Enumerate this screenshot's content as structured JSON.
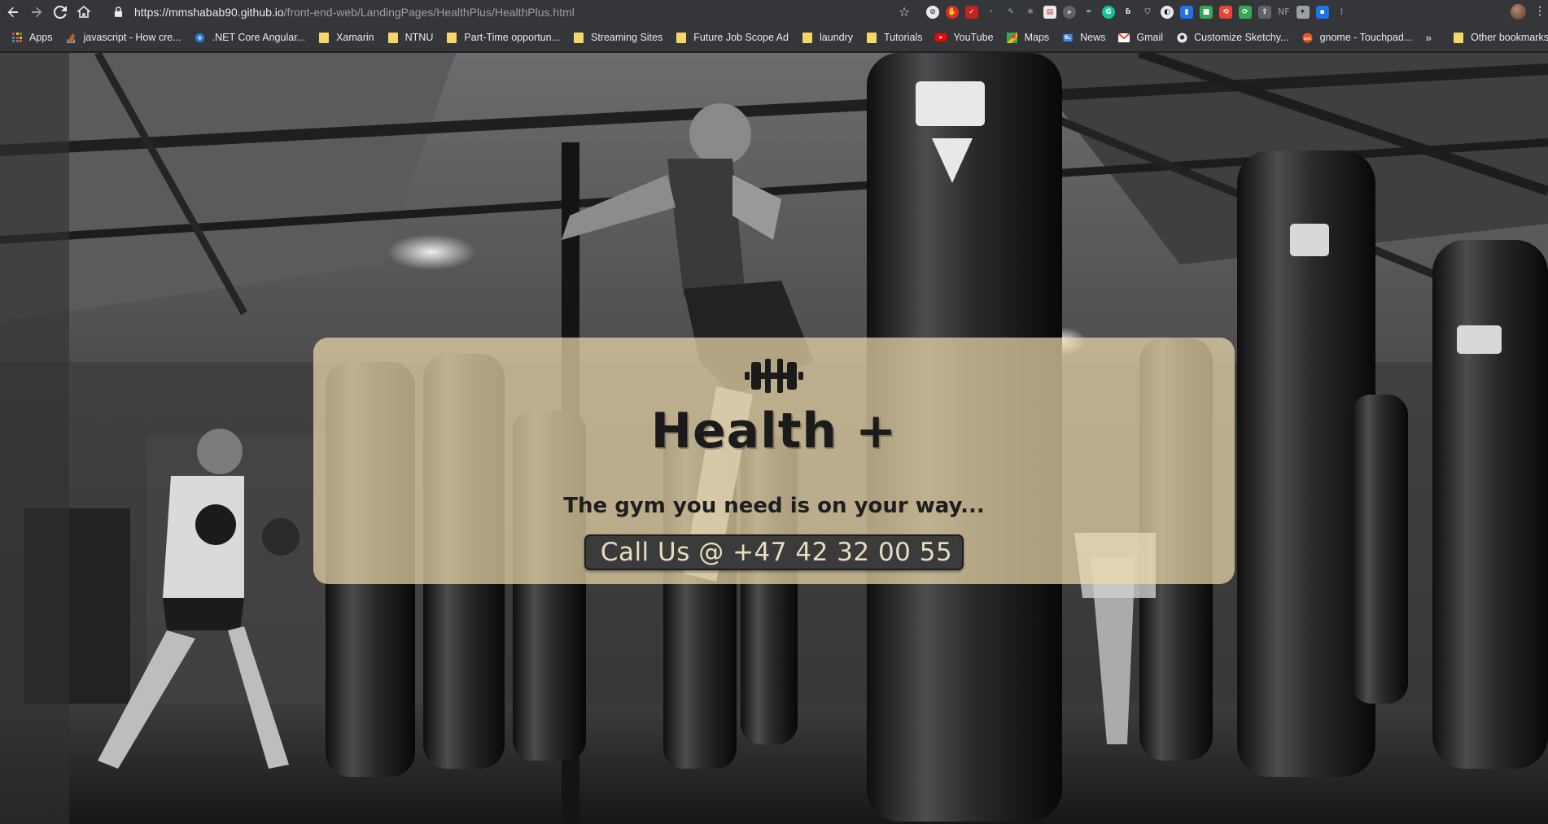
{
  "browser": {
    "url_host": "https://mmshabab90.github.io",
    "url_path": "/front-end-web/LandingPages/HealthPlus/HealthPlus.html",
    "extensions_text": "NF"
  },
  "bookmarks": {
    "items": [
      {
        "label": "Apps",
        "icon": "apps-grid-icon"
      },
      {
        "label": "javascript - How cre...",
        "icon": "stackoverflow-icon"
      },
      {
        "label": ".NET Core Angular...",
        "icon": "dotnet-icon"
      },
      {
        "label": "Xamarin",
        "icon": "folder-icon"
      },
      {
        "label": "NTNU",
        "icon": "folder-icon"
      },
      {
        "label": "Part-Time opportun...",
        "icon": "folder-icon"
      },
      {
        "label": "Streaming Sites",
        "icon": "folder-icon"
      },
      {
        "label": "Future Job Scope Ad",
        "icon": "folder-icon"
      },
      {
        "label": "laundry",
        "icon": "folder-icon"
      },
      {
        "label": "Tutorials",
        "icon": "folder-icon"
      },
      {
        "label": "YouTube",
        "icon": "youtube-icon"
      },
      {
        "label": "Maps",
        "icon": "maps-icon"
      },
      {
        "label": "News",
        "icon": "news-icon"
      },
      {
        "label": "Gmail",
        "icon": "gmail-icon"
      },
      {
        "label": "Customize Sketchy...",
        "icon": "github-icon"
      },
      {
        "label": "gnome - Touchpad...",
        "icon": "askubuntu-icon"
      }
    ],
    "more": "»",
    "other": "Other bookmarks"
  },
  "hero": {
    "title": "Health +",
    "tagline": "The gym you need is on your way...",
    "call_label": "Call Us @ +47 42 32 00 55"
  },
  "colors": {
    "card": "#ecd7aa",
    "button": "#3b3b3b",
    "button_text": "#e9dcc0"
  }
}
